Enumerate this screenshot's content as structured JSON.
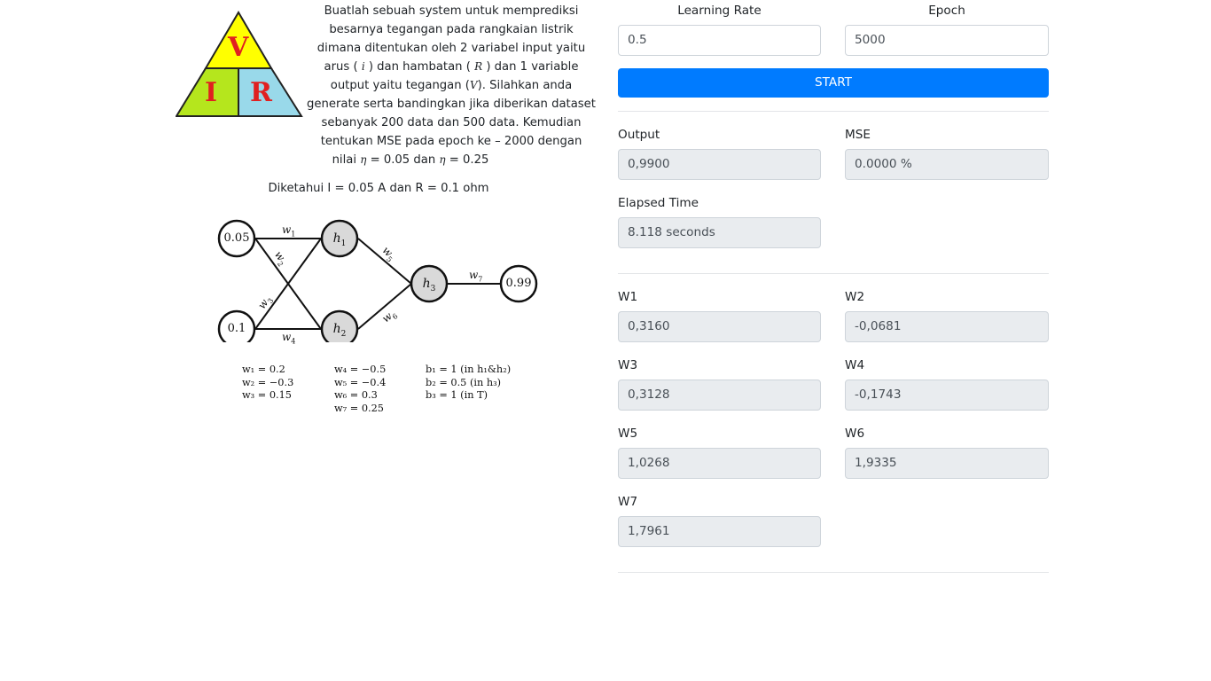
{
  "problem": {
    "line1": "Buatlah sebuah system untuk memprediksi",
    "line2": "besarnya tegangan pada rangkaian listrik",
    "line3": "dimana ditentukan oleh 2 variabel input yaitu",
    "line4_pre": "arus ( ",
    "line4_var": "i",
    "line4_mid": " ) dan hambatan ( ",
    "line4_var2": "R",
    "line4_post": " ) dan 1 variable",
    "line5_pre": "output yaitu tegangan (",
    "line5_var": "V",
    "line5_post": "). Silahkan anda",
    "line6": "generate serta bandingkan jika diberikan dataset",
    "line7": "sebanyak 200 data dan 500 data. Kemudian",
    "line8": "tentukan MSE pada epoch ke – 2000 dengan",
    "line9_pre": "nilai ",
    "line9_eta1": "η",
    "line9_mid": " = 0.05 dan ",
    "line9_eta2": "η",
    "line9_post": " = 0.25"
  },
  "vir": {
    "v": "V",
    "i": "I",
    "r": "R"
  },
  "given": "Diketahui I = 0.05 A dan R = 0.1 ohm",
  "network": {
    "in1": "0.05",
    "in2": "0.1",
    "h1": "h",
    "h1_sub": "1",
    "h2": "h",
    "h2_sub": "2",
    "h3": "h",
    "h3_sub": "3",
    "out": "0.99",
    "w": "w",
    "w1_sub": "1",
    "w2_sub": "2",
    "w3_sub": "3",
    "w4_sub": "4",
    "w5_sub": "5",
    "w6_sub": "6",
    "w7_sub": "7"
  },
  "params": {
    "col1": [
      "w₁ = 0.2",
      "w₂ = −0.3",
      "w₃ = 0.15"
    ],
    "col2": [
      "w₄ = −0.5",
      "w₅ = −0.4",
      "w₆ = 0.3",
      "w₇ = 0.25"
    ],
    "col3": [
      "b₁ = 1 (in h₁&h₂)",
      "b₂ = 0.5 (in h₃)",
      "b₃ = 1 (in T)"
    ]
  },
  "form": {
    "learning_rate_label": "Learning Rate",
    "learning_rate_value": "0.5",
    "epoch_label": "Epoch",
    "epoch_value": "5000",
    "start_label": "START"
  },
  "results": {
    "output_label": "Output",
    "output_value": "0,9900",
    "mse_label": "MSE",
    "mse_value": "0.0000 %",
    "elapsed_label": "Elapsed Time",
    "elapsed_value": "8.118 seconds"
  },
  "weights": {
    "w1_label": "W1",
    "w1_value": "0,3160",
    "w2_label": "W2",
    "w2_value": "-0,0681",
    "w3_label": "W3",
    "w3_value": "0,3128",
    "w4_label": "W4",
    "w4_value": "-0,1743",
    "w5_label": "W5",
    "w5_value": "1,0268",
    "w6_label": "W6",
    "w6_value": "1,9335",
    "w7_label": "W7",
    "w7_value": "1,7961"
  },
  "colors": {
    "vir_yellow": "#ffff00",
    "vir_green": "#b5e61d",
    "vir_blue": "#99d9ea",
    "vir_letters": "#e02020",
    "primary": "#007bff",
    "readonly_bg": "#e9ecef",
    "hidden_node": "#d9d9d9"
  }
}
